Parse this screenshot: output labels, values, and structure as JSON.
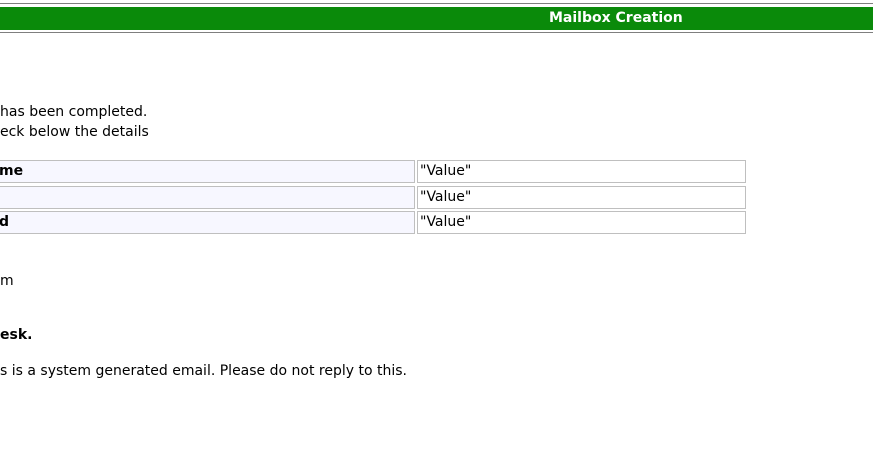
{
  "header": {
    "title": "Mailbox Creation",
    "color": "#0a8a0a"
  },
  "body": {
    "line1": "has been completed.",
    "line2": "eck below the details"
  },
  "details": {
    "rows": [
      {
        "label": "me",
        "value": "\"Value\""
      },
      {
        "label": "",
        "value": "\"Value\""
      },
      {
        "label": "d",
        "value": "\"Value\""
      }
    ]
  },
  "footer": {
    "line1": "m",
    "line2": "esk.",
    "line3": "s is a system generated email. Please do not reply to this."
  }
}
